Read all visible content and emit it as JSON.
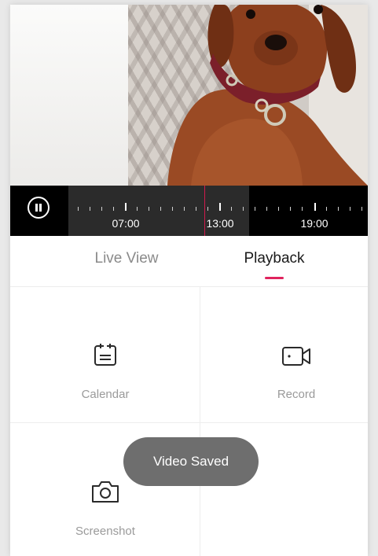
{
  "timeline": {
    "labels": [
      "07:00",
      "13:00",
      "19:00"
    ]
  },
  "tabs": {
    "live_view": "Live View",
    "playback": "Playback",
    "active_color": "#e0245e"
  },
  "actions": {
    "calendar": "Calendar",
    "record": "Record",
    "screenshot": "Screenshot"
  },
  "icons": {
    "pause": "pause-icon",
    "calendar": "calendar-icon",
    "record": "video-camera-icon",
    "screenshot": "camera-icon"
  },
  "toast": {
    "message": "Video Saved"
  }
}
